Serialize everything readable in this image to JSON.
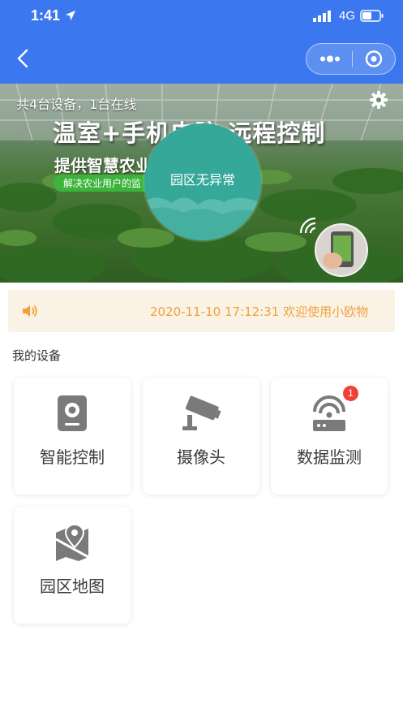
{
  "status_bar": {
    "time": "1:41",
    "network": "4G"
  },
  "banner": {
    "device_count_text": "共4台设备，1台在线",
    "headline": "温室+手机电脑 远程控制",
    "subline": "提供智慧农业",
    "tag": "解决农业用户的监",
    "status_text": "园区无异常"
  },
  "notice": {
    "text": "2020-11-10 17:12:31 欢迎使用小欧物"
  },
  "section": {
    "title": "我的设备"
  },
  "devices": [
    {
      "label": "智能控制",
      "icon": "control-box-icon",
      "badge": ""
    },
    {
      "label": "摄像头",
      "icon": "camera-icon",
      "badge": ""
    },
    {
      "label": "数据监测",
      "icon": "router-icon",
      "badge": "1"
    },
    {
      "label": "园区地图",
      "icon": "map-icon",
      "badge": ""
    }
  ],
  "colors": {
    "primary": "#3b78f0",
    "notice_text": "#f0a13a",
    "badge": "#f04134",
    "status_circle": "#35a89a"
  }
}
